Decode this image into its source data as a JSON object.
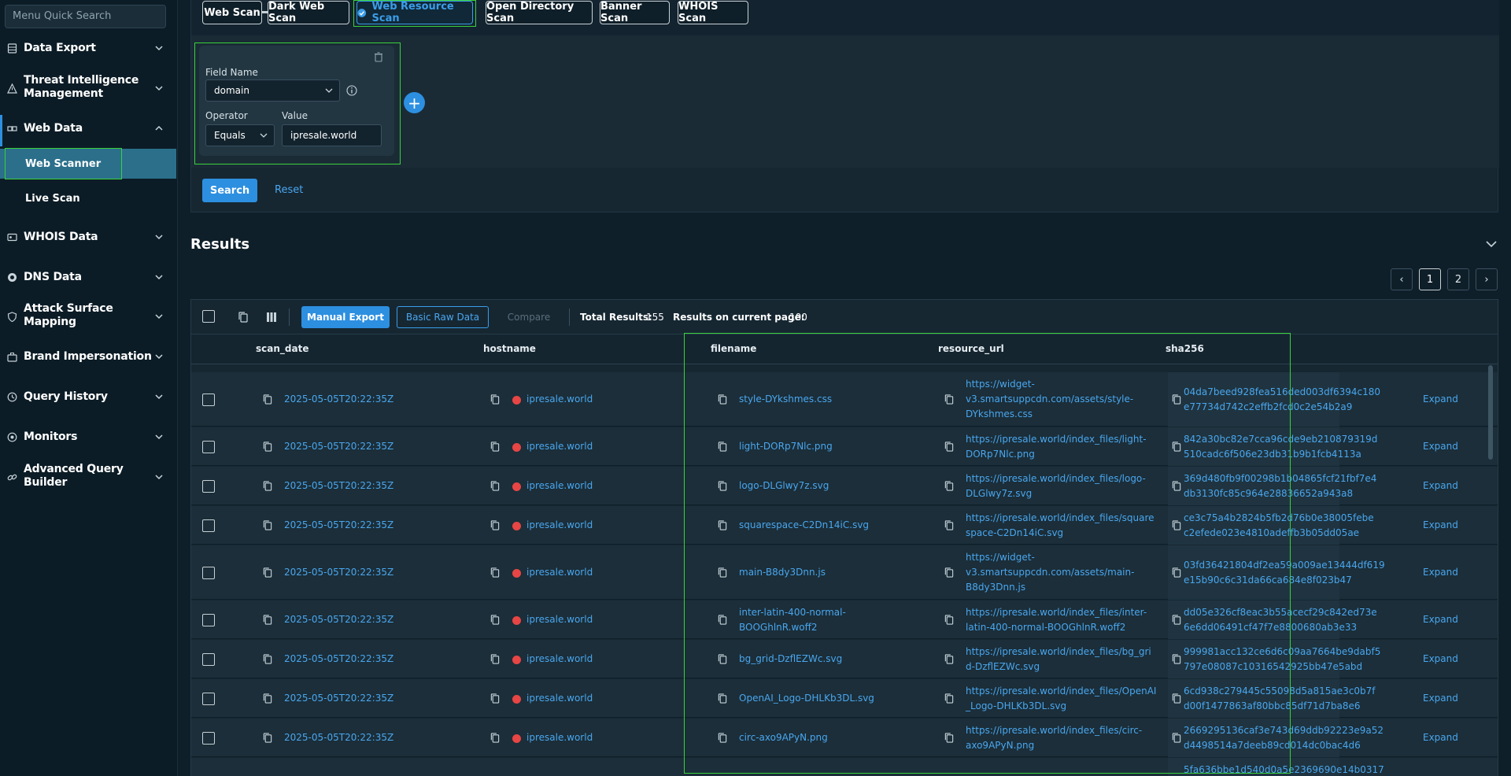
{
  "sidebar": {
    "search_placeholder": "Menu Quick Search",
    "items": [
      {
        "label": "Data Export",
        "icon": "database-icon",
        "expanded": false
      },
      {
        "label": "Threat Intelligence Management",
        "icon": "warning-triangle-icon",
        "expanded": false
      },
      {
        "label": "Web Data",
        "icon": "network-icon",
        "expanded": true
      },
      {
        "label": "WHOIS Data",
        "icon": "id-card-icon",
        "expanded": false
      },
      {
        "label": "DNS Data",
        "icon": "globe-icon",
        "expanded": false
      },
      {
        "label": "Attack Surface Mapping",
        "icon": "shield-icon",
        "expanded": false
      },
      {
        "label": "Brand Impersonation",
        "icon": "briefcase-icon",
        "expanded": false
      },
      {
        "label": "Query History",
        "icon": "history-icon",
        "expanded": false
      },
      {
        "label": "Monitors",
        "icon": "monitor-icon",
        "expanded": false
      },
      {
        "label": "Advanced Query Builder",
        "icon": "link-icon",
        "expanded": false
      }
    ],
    "sub_items": [
      {
        "label": "Web Scanner",
        "active": true
      },
      {
        "label": "Live Scan",
        "active": false
      }
    ]
  },
  "scan_tabs": [
    {
      "label": "Web Scan",
      "active": false
    },
    {
      "label": "Dark Web Scan",
      "active": false
    },
    {
      "label": "Web Resource Scan",
      "active": true
    },
    {
      "label": "Open Directory Scan",
      "active": false
    },
    {
      "label": "Banner Scan",
      "active": false
    },
    {
      "label": "WHOIS Scan",
      "active": false
    }
  ],
  "filter": {
    "field_name_label": "Field Name",
    "field_name_value": "domain",
    "operator_label": "Operator",
    "operator_value": "Equals",
    "value_label": "Value",
    "value_value": "ipresale.world"
  },
  "actions": {
    "search": "Search",
    "reset": "Reset"
  },
  "results": {
    "title": "Results",
    "pagination": {
      "pages": [
        "1",
        "2"
      ],
      "current": "1"
    },
    "toolbar": {
      "manual_export": "Manual Export",
      "basic_raw_data": "Basic Raw Data",
      "compare": "Compare",
      "total_label": "Total Results:",
      "total_value": "155",
      "page_label": "Results on current page:",
      "page_value": "100"
    },
    "columns": [
      "scan_date",
      "hostname",
      "filename",
      "resource_url",
      "sha256"
    ],
    "expand_label": "Expand",
    "rows": [
      {
        "scan_date": "2025-05-05T20:22:35Z",
        "hostname": "ipresale.world",
        "filename": [
          "style-DYkshmes.css"
        ],
        "resource_url": [
          "https://widget-",
          "v3.smartsuppcdn.com/assets/style-",
          "DYkshmes.css"
        ],
        "sha256": [
          "04da7beed928fea516ded003df6394c180",
          "e77734d742c2effb2fcd0c2e54b2a9"
        ]
      },
      {
        "scan_date": "2025-05-05T20:22:35Z",
        "hostname": "ipresale.world",
        "filename": [
          "light-DORp7Nlc.png"
        ],
        "resource_url": [
          "https://ipresale.world/index_files/light-",
          "DORp7Nlc.png"
        ],
        "sha256": [
          "842a30bc82e7cca96cde9eb210879319d",
          "510cadc6f506e23db31b9b1fcb4113a"
        ]
      },
      {
        "scan_date": "2025-05-05T20:22:35Z",
        "hostname": "ipresale.world",
        "filename": [
          "logo-DLGlwy7z.svg"
        ],
        "resource_url": [
          "https://ipresale.world/index_files/logo-",
          "DLGlwy7z.svg"
        ],
        "sha256": [
          "369d480fb9f00298b1b04865fcf21fbf7e4",
          "db3130fc85c964e28836652a943a8"
        ]
      },
      {
        "scan_date": "2025-05-05T20:22:35Z",
        "hostname": "ipresale.world",
        "filename": [
          "squarespace-C2Dn14iC.svg"
        ],
        "resource_url": [
          "https://ipresale.world/index_files/square",
          "space-C2Dn14iC.svg"
        ],
        "sha256": [
          "ce3c75a4b2824b5fb2d76b0e38005febe",
          "c2efede023e4810adeffb3b05dd05ae"
        ]
      },
      {
        "scan_date": "2025-05-05T20:22:35Z",
        "hostname": "ipresale.world",
        "filename": [
          "main-B8dy3Dnn.js"
        ],
        "resource_url": [
          "https://widget-",
          "v3.smartsuppcdn.com/assets/main-",
          "B8dy3Dnn.js"
        ],
        "sha256": [
          "03fd36421804df2ea59a009ae13444df619",
          "e15b90c6c31da66ca684e8f023b47"
        ]
      },
      {
        "scan_date": "2025-05-05T20:22:35Z",
        "hostname": "ipresale.world",
        "filename": [
          "inter-latin-400-normal-",
          "BOOGhlnR.woff2"
        ],
        "resource_url": [
          "https://ipresale.world/index_files/inter-",
          "latin-400-normal-BOOGhlnR.woff2"
        ],
        "sha256": [
          "dd05e326cf8eac3b55acecf29c842ed73e",
          "6e6dd06491cf47f7e8800680ab3e33"
        ]
      },
      {
        "scan_date": "2025-05-05T20:22:35Z",
        "hostname": "ipresale.world",
        "filename": [
          "bg_grid-DzflEZWc.svg"
        ],
        "resource_url": [
          "https://ipresale.world/index_files/bg_gri",
          "d-DzflEZWc.svg"
        ],
        "sha256": [
          "999981acc132ce6d6c09aa7664be9dabf5",
          "797e08087c10316542925bb47e5abd"
        ]
      },
      {
        "scan_date": "2025-05-05T20:22:35Z",
        "hostname": "ipresale.world",
        "filename": [
          "OpenAI_Logo-DHLKb3DL.svg"
        ],
        "resource_url": [
          "https://ipresale.world/index_files/OpenAI",
          "_Logo-DHLKb3DL.svg"
        ],
        "sha256": [
          "6cd938c279445c55098d5a815ae3c0b7f",
          "d00f1477863af80bbc85df71d7ba8e6"
        ]
      },
      {
        "scan_date": "2025-05-05T20:22:35Z",
        "hostname": "ipresale.world",
        "filename": [
          "circ-axo9APyN.png"
        ],
        "resource_url": [
          "https://ipresale.world/index_files/circ-",
          "axo9APyN.png"
        ],
        "sha256": [
          "2669295136caf3e743d69ddb92223e9a52",
          "d4498514a7deeb89cd014dc0bac4d6"
        ]
      },
      {
        "scan_date": "",
        "hostname": "",
        "filename": [
          ""
        ],
        "resource_url": [
          ""
        ],
        "sha256": [
          "5fa636bbe1d540d0a5e2369690e14b0317"
        ]
      }
    ]
  },
  "colors": {
    "accent": "#2d8fe0",
    "link": "#4aa6ee",
    "highlight": "#3ad13a",
    "status_dot": "#e84545"
  }
}
